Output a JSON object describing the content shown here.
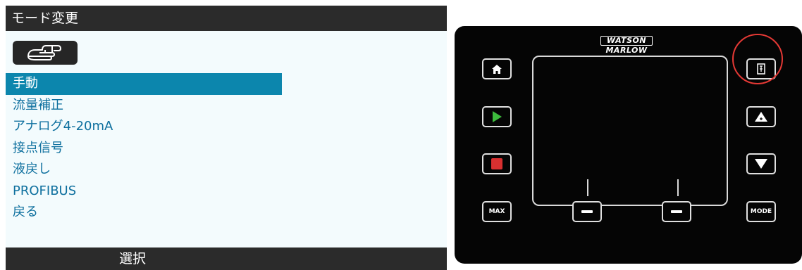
{
  "screen": {
    "title": "モード変更",
    "menu_items": [
      {
        "label": "手動",
        "selected": true
      },
      {
        "label": "流量補正",
        "selected": false
      },
      {
        "label": "アナログ4-20mA",
        "selected": false
      },
      {
        "label": "接点信号",
        "selected": false
      },
      {
        "label": "液戻し",
        "selected": false
      },
      {
        "label": "PROFIBUS",
        "selected": false
      },
      {
        "label": "戻る",
        "selected": false
      }
    ],
    "footer_label": "選択",
    "icons": {
      "header_icon": "hand-pointing-icon"
    }
  },
  "keypad": {
    "brand_line1": "WATSON",
    "brand_line2": "MARLOW",
    "keys": {
      "home": "home-icon",
      "start": "play-icon",
      "stop": "stop-icon",
      "max_label": "MAX",
      "softkey_left": "minus-icon",
      "softkey_right": "minus-icon",
      "info": "info-icon",
      "up": "up-arrow-icon",
      "down": "down-arrow-icon",
      "mode_label": "MODE"
    },
    "highlighted_key": "info"
  },
  "colors": {
    "title_bar": "#2b2b2b",
    "menu_text": "#0d6f9e",
    "selected_bg": "#0c86ad",
    "screen_bg": "#f3fbfd",
    "start_green": "#3dbb3d",
    "stop_red": "#d93030",
    "highlight_circle": "#e53935"
  }
}
